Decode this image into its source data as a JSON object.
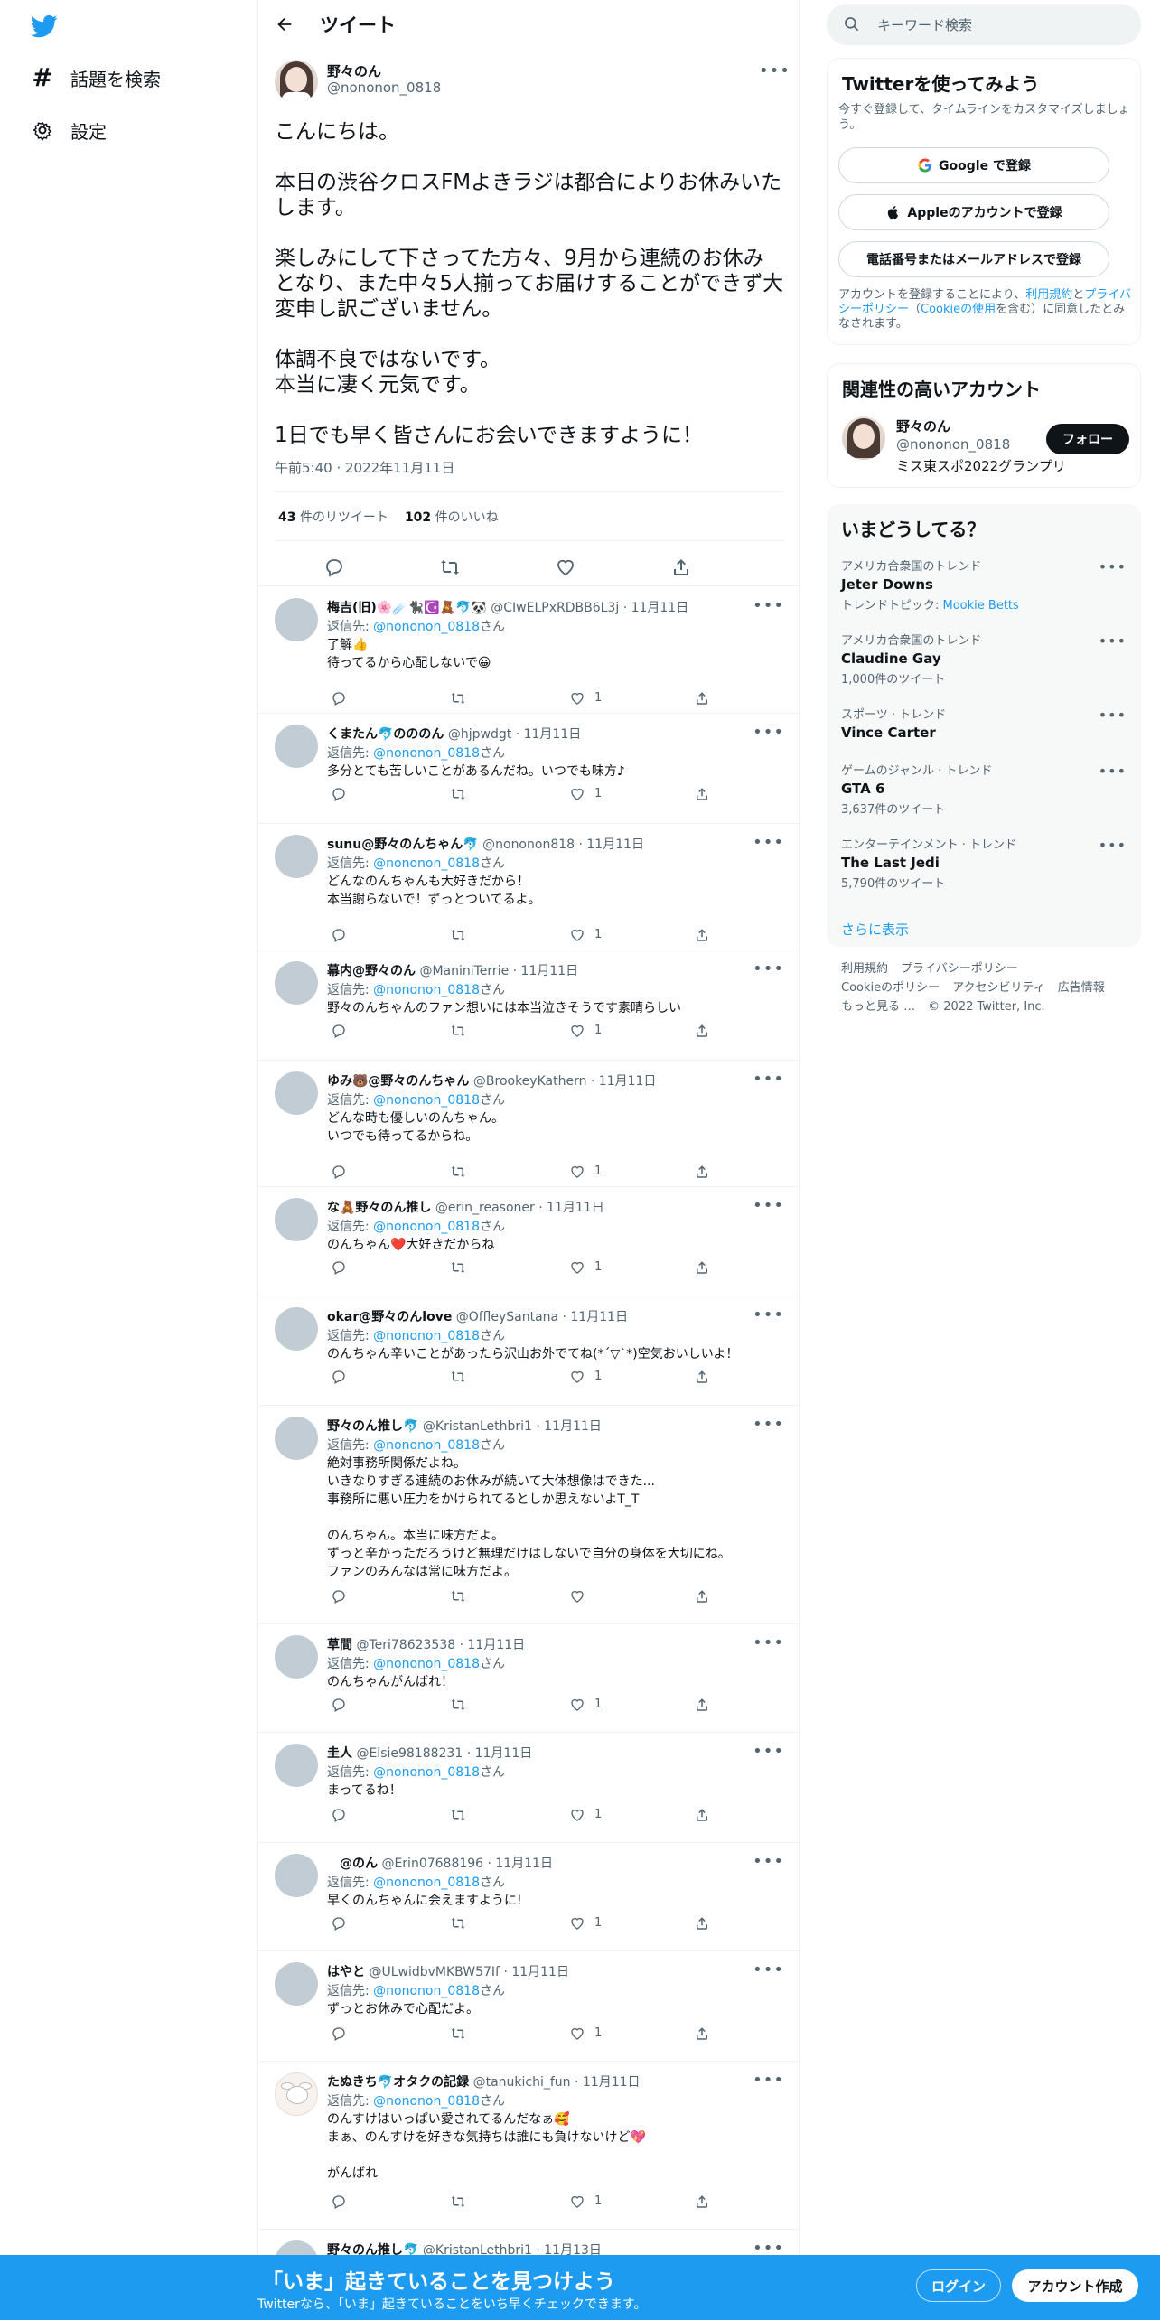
{
  "nav": {
    "explore_label": "話題を検索",
    "settings_label": "設定"
  },
  "header": {
    "title": "ツイート"
  },
  "main_tweet": {
    "name": "野々のん",
    "handle": "@nononon_0818",
    "text": "こんにちは。\n\n本日の渋谷クロスFMよきラジは都合によりお休みいたします。\n\n楽しみにして下さってた方々、9月から連続のお休みとなり、また中々5人揃ってお届けすることができず大変申し訳ございません。\n\n体調不良ではないです。\n本当に凄く元気です。\n\n1日でも早く皆さんにお会いできますように！",
    "timestamp": "午前5:40 · 2022年11月11日",
    "retweets_count": "43",
    "retweets_label": "件のリツイート",
    "likes_count": "102",
    "likes_label": "件のいいね"
  },
  "replies": [
    {
      "name": "梅吉(旧)🌸☄️🐈‍⬛☪️🧸🐬🐼",
      "handle": "@CIwELPxRDBB6L3j",
      "date": "· 11月11日",
      "reply_to_label": "返信先:",
      "reply_to": "@nononon_0818",
      "reply_to_suffix": "さん",
      "text": "了解👍\n待ってるから心配しないで😀",
      "likes": "1"
    },
    {
      "name": "くまたん🐬のののん",
      "handle": "@hjpwdgt",
      "date": "· 11月11日",
      "reply_to_label": "返信先:",
      "reply_to": "@nononon_0818",
      "reply_to_suffix": "さん",
      "text": "多分とても苦しいことがあるんだね。いつでも味方♪",
      "likes": "1"
    },
    {
      "name": "sunu@野々のんちゃん🐬",
      "handle": "@nononon818",
      "date": "· 11月11日",
      "reply_to_label": "返信先:",
      "reply_to": "@nononon_0818",
      "reply_to_suffix": "さん",
      "text": "どんなのんちゃんも大好きだから！\n本当謝らないで！ずっとついてるよ。",
      "likes": "1"
    },
    {
      "name": "幕内@野々のん",
      "handle": "@ManiniTerrie",
      "date": "· 11月11日",
      "reply_to_label": "返信先:",
      "reply_to": "@nononon_0818",
      "reply_to_suffix": "さん",
      "text": "野々のんちゃんのファン想いには本当泣きそうです素晴らしい",
      "likes": "1"
    },
    {
      "name": "ゆみ🐻@野々のんちゃん",
      "handle": "@BrookeyKathern",
      "date": "· 11月11日",
      "reply_to_label": "返信先:",
      "reply_to": "@nononon_0818",
      "reply_to_suffix": "さん",
      "text": "どんな時も優しいのんちゃん。\nいつでも待ってるからね。",
      "likes": "1"
    },
    {
      "name": "な🧸野々のん推し",
      "handle": "@erin_reasoner",
      "date": "· 11月11日",
      "reply_to_label": "返信先:",
      "reply_to": "@nononon_0818",
      "reply_to_suffix": "さん",
      "text": "のんちゃん❤️大好きだからね",
      "likes": "1"
    },
    {
      "name": "okar@野々のんlove",
      "handle": "@OffleySantana",
      "date": "· 11月11日",
      "reply_to_label": "返信先:",
      "reply_to": "@nononon_0818",
      "reply_to_suffix": "さん",
      "text": "のんちゃん辛いことがあったら沢山お外でてね(*´▽`*)空気おいしいよ！",
      "likes": "1"
    },
    {
      "name": "野々のん推し🐬",
      "handle": "@KristanLethbri1",
      "date": "· 11月11日",
      "reply_to_label": "返信先:",
      "reply_to": "@nononon_0818",
      "reply_to_suffix": "さん",
      "text": "絶対事務所関係だよね。\nいきなりすぎる連続のお休みが続いて大体想像はできた...\n事務所に悪い圧力をかけられてるとしか思えないよT_T\n\nのんちゃん。本当に味方だよ。\nずっと辛かっただろうけど無理だけはしないで自分の身体を大切にね。\nファンのみんなは常に味方だよ。",
      "likes": ""
    },
    {
      "name": "草間",
      "handle": "@Teri78623538",
      "date": "· 11月11日",
      "reply_to_label": "返信先:",
      "reply_to": "@nononon_0818",
      "reply_to_suffix": "さん",
      "text": "のんちゃんがんばれ！",
      "likes": "1"
    },
    {
      "name": "圭人",
      "handle": "@Elsie98188231",
      "date": "· 11月11日",
      "reply_to_label": "返信先:",
      "reply_to": "@nononon_0818",
      "reply_to_suffix": "さん",
      "text": "まってるね！",
      "likes": "1"
    },
    {
      "name": "　@のん",
      "handle": "@Erin07688196",
      "date": "· 11月11日",
      "reply_to_label": "返信先:",
      "reply_to": "@nononon_0818",
      "reply_to_suffix": "さん",
      "text": "早くのんちゃんに会えますように!",
      "likes": "1"
    },
    {
      "name": "はやと",
      "handle": "@ULwidbvMKBW57If",
      "date": "· 11月11日",
      "reply_to_label": "返信先:",
      "reply_to": "@nononon_0818",
      "reply_to_suffix": "さん",
      "text": "ずっとお休みで心配だよ。",
      "likes": "1"
    },
    {
      "name": "たぬきち🐬オタクの記録",
      "handle": "@tanukichi_fun",
      "date": "· 11月11日",
      "reply_to_label": "返信先:",
      "reply_to": "@nononon_0818",
      "reply_to_suffix": "さん",
      "text": "のんすけはいっぱい愛されてるんだなぁ🥰\nまぁ、のんすけを好きな気持ちは誰にも負けないけど💖\n\nがんばれ",
      "likes": "1"
    },
    {
      "name": "野々のん推し🐬",
      "handle": "@KristanLethbri1",
      "date": "· 11月13日",
      "reply_to_label": "",
      "reply_to": "",
      "reply_to_suffix": "",
      "text": "",
      "likes": ""
    }
  ],
  "search": {
    "placeholder": "キーワード検索"
  },
  "signup": {
    "title": "Twitterを使ってみよう",
    "subtitle": "今すぐ登録して、タイムラインをカスタマイズしましょう。",
    "google": "Google で登録",
    "apple": "Appleのアカウントで登録",
    "phone": "電話番号またはメールアドレスで登録",
    "terms_pre": "アカウントを登録することにより、",
    "terms_link1": "利用規約",
    "terms_mid": "と",
    "terms_link2": "プライバシーポリシー",
    "terms_mid2": "（",
    "terms_link3": "Cookieの使用",
    "terms_post": "を含む）に同意したとみなされます。"
  },
  "related": {
    "title": "関連性の高いアカウント",
    "name": "野々のん",
    "handle": "@nononon_0818",
    "bio": "ミス東スポ2022グランプリ",
    "follow": "フォロー"
  },
  "trends": {
    "title": "いまどうしてる？",
    "items": [
      {
        "category": "アメリカ合衆国のトレンド",
        "title": "Jeter Downs",
        "sub_prefix": "トレンドトピック: ",
        "sub_link": "Mookie Betts"
      },
      {
        "category": "アメリカ合衆国のトレンド",
        "title": "Claudine Gay",
        "sub_prefix": "1,000件のツイート",
        "sub_link": ""
      },
      {
        "category": "スポーツ · トレンド",
        "title": "Vince Carter",
        "sub_prefix": "",
        "sub_link": ""
      },
      {
        "category": "ゲームのジャンル · トレンド",
        "title": "GTA 6",
        "sub_prefix": "3,637件のツイート",
        "sub_link": ""
      },
      {
        "category": "エンターテインメント · トレンド",
        "title": "The Last Jedi",
        "sub_prefix": "5,790件のツイート",
        "sub_link": ""
      }
    ],
    "show_more": "さらに表示"
  },
  "footer": {
    "links": [
      "利用規約",
      "プライバシーポリシー",
      "Cookieのポリシー",
      "アクセシビリティ",
      "広告情報",
      "もっと見る …",
      "© 2022 Twitter, Inc."
    ]
  },
  "bottom_bar": {
    "title": "「いま」起きていることを見つけよう",
    "subtitle": "Twitterなら、「いま」起きていることをいち早くチェックできます。",
    "login": "ログイン",
    "signup": "アカウント作成"
  },
  "colors": {
    "accent": "#1d9bf0",
    "text": "#0f1419",
    "muted": "#536471"
  }
}
